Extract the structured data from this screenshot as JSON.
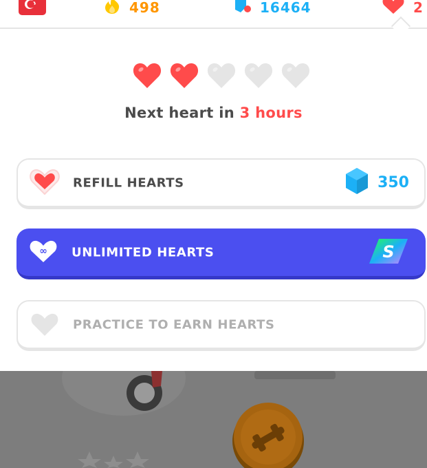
{
  "topbar": {
    "flag_icon": "turkey-flag-icon",
    "streak": {
      "icon": "flame-icon",
      "value": "498"
    },
    "gems": {
      "icon": "gem-icon",
      "value": "16464"
    },
    "hearts": {
      "icon": "heart-icon",
      "value": "2"
    }
  },
  "hearts_panel": {
    "hearts_total": 5,
    "hearts_filled": 2,
    "next_heart_prefix": "Next heart in ",
    "next_heart_time": "3 hours"
  },
  "options": {
    "refill": {
      "label": "REFILL HEARTS",
      "price": "350",
      "price_icon": "gem-icon"
    },
    "unlimited": {
      "label": "UNLIMITED HEARTS",
      "badge_icon": "super-badge-icon"
    },
    "practice": {
      "label": "PRACTICE TO EARN HEARTS"
    }
  },
  "colors": {
    "heart_red": "#ff4b4b",
    "heart_empty": "#e5e5e5",
    "gem_blue": "#1cb0f6",
    "streak_orange": "#ff9600",
    "unlimited_bg": "#4b4ff0",
    "text_dark": "#4b4b4b",
    "text_muted": "#afafaf"
  }
}
